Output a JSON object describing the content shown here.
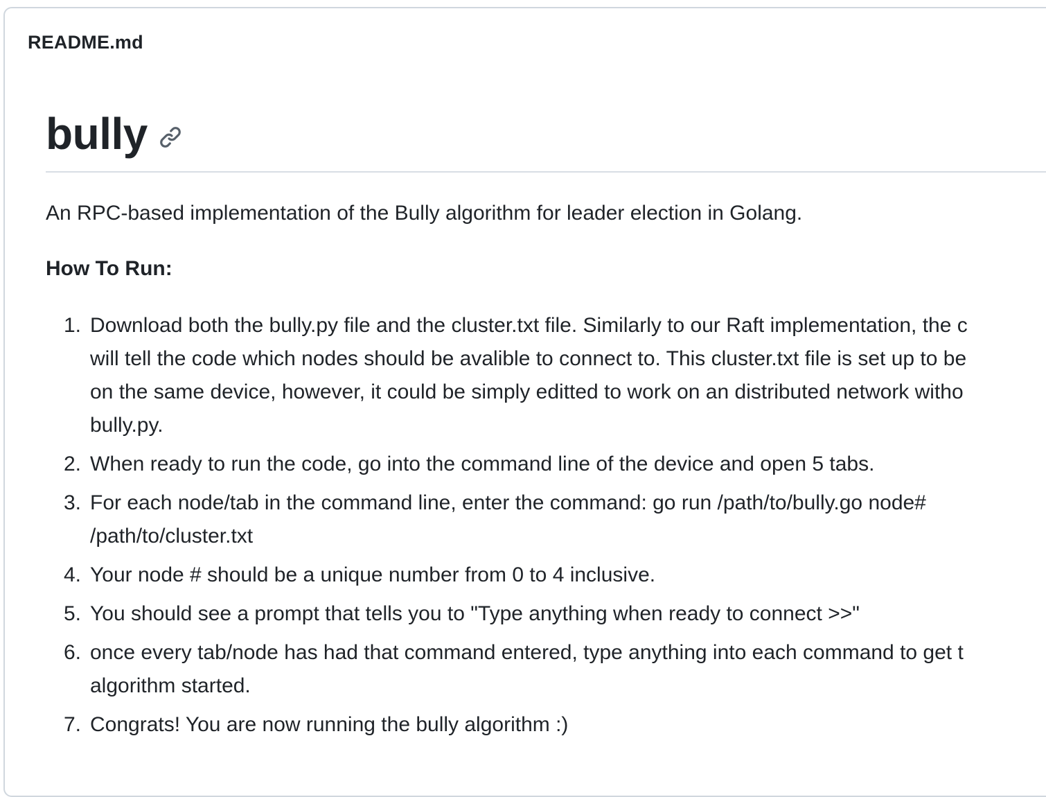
{
  "readme": {
    "filename": "README.md",
    "title": "bully",
    "anchor_icon": "link-icon",
    "description": "An RPC-based implementation of the Bully algorithm for leader election in Golang.",
    "how_to_run_heading": "How To Run:",
    "steps": [
      {
        "number": "1.",
        "lines": [
          "Download both the bully.py file and the cluster.txt file. Similarly to our Raft implementation, the c",
          "will tell the code which nodes should be avalible to connect to. This cluster.txt file is set up to be",
          "on the same device, however, it could be simply editted to work on an distributed network witho",
          "bully.py."
        ]
      },
      {
        "number": "2.",
        "lines": [
          "When ready to run the code, go into the command line of the device and open 5 tabs."
        ]
      },
      {
        "number": "3.",
        "lines": [
          "For each node/tab in the command line, enter the command: go run /path/to/bully.go node#",
          "/path/to/cluster.txt"
        ]
      },
      {
        "number": "4.",
        "lines": [
          "Your node # should be a unique number from 0 to 4 inclusive."
        ]
      },
      {
        "number": "5.",
        "lines": [
          "You should see a prompt that tells you to \"Type anything when ready to connect >>\""
        ]
      },
      {
        "number": "6.",
        "lines": [
          "once every tab/node has had that command entered, type anything into each command to get t",
          "algorithm started."
        ]
      },
      {
        "number": "7.",
        "lines": [
          "Congrats! You are now running the bully algorithm :)"
        ]
      }
    ]
  },
  "colors": {
    "text": "#1f2328",
    "border": "#d0d7de",
    "rule": "#d8dee4",
    "icon": "#57606a"
  }
}
